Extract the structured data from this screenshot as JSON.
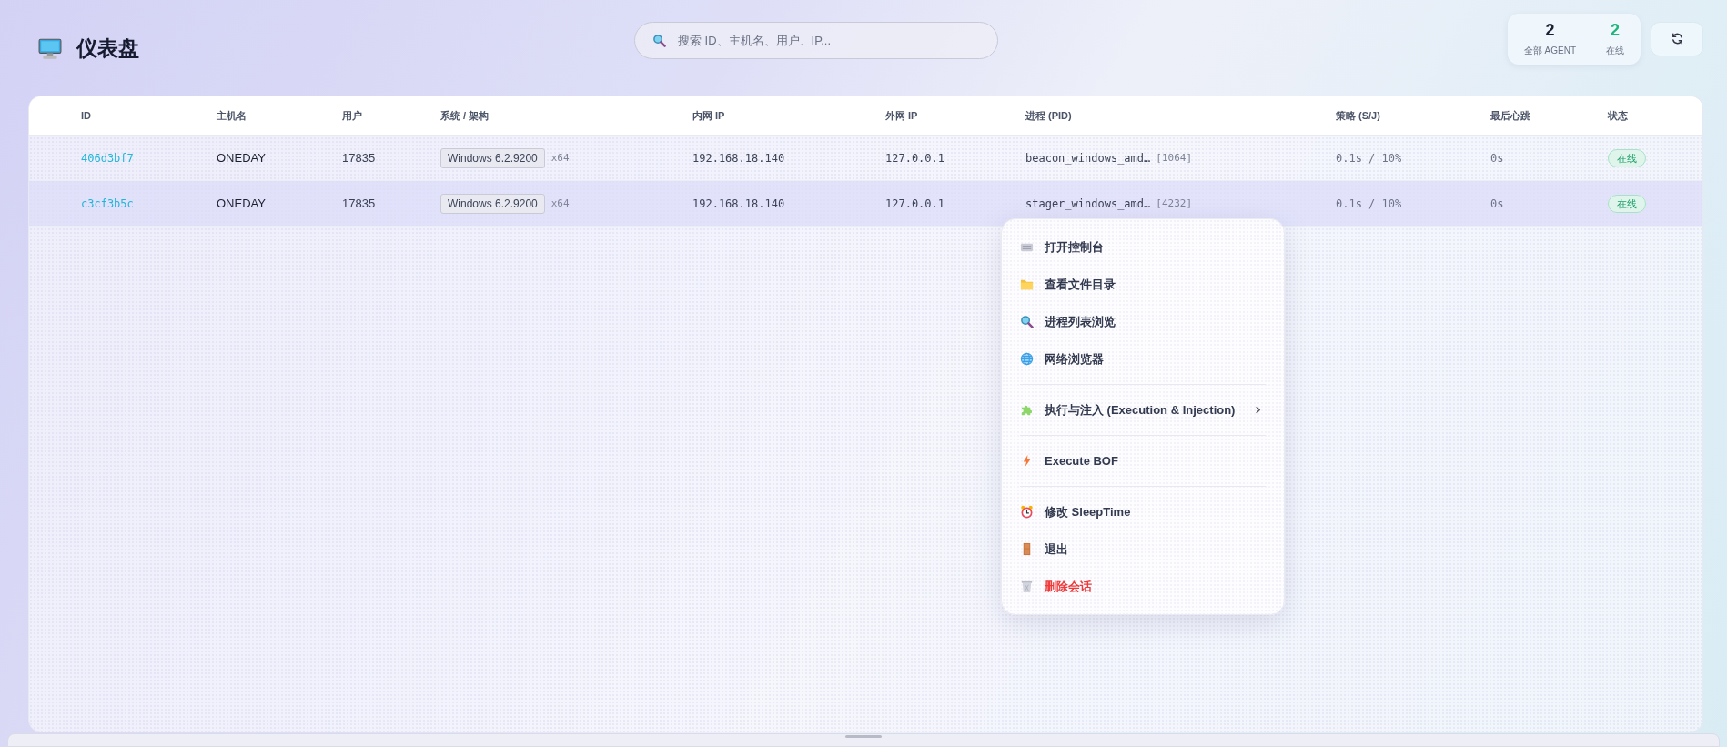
{
  "header": {
    "title": "仪表盘",
    "search": {
      "placeholder": "搜索 ID、主机名、用户、IP..."
    },
    "stats": [
      {
        "value": "2",
        "label": "全部 AGENT",
        "kind": "total"
      },
      {
        "value": "2",
        "label": "在线",
        "kind": "online"
      }
    ]
  },
  "table": {
    "columns": [
      "ID",
      "主机名",
      "用户",
      "系统 / 架构",
      "内网 IP",
      "外网 IP",
      "进程 (PID)",
      "策略 (S/J)",
      "最后心跳",
      "状态"
    ],
    "rows": [
      {
        "id": "406d3bf7",
        "host": "ONEDAY",
        "user": "17835",
        "os": "Windows 6.2.9200",
        "arch": "x64",
        "internal_ip": "192.168.18.140",
        "external_ip": "127.0.0.1",
        "process": "beacon_windows_amd…",
        "pid": "[1064]",
        "policy": "0.1s / 10%",
        "heartbeat": "0s",
        "status": "在线",
        "selected": false
      },
      {
        "id": "c3cf3b5c",
        "host": "ONEDAY",
        "user": "17835",
        "os": "Windows 6.2.9200",
        "arch": "x64",
        "internal_ip": "192.168.18.140",
        "external_ip": "127.0.0.1",
        "process": "stager_windows_amd…",
        "pid": "[4232]",
        "policy": "0.1s / 10%",
        "heartbeat": "0s",
        "status": "在线",
        "selected": true
      }
    ]
  },
  "context_menu": {
    "groups": [
      [
        {
          "label": "打开控制台",
          "danger": false,
          "has_submenu": false
        },
        {
          "label": "查看文件目录",
          "danger": false,
          "has_submenu": false
        },
        {
          "label": "进程列表浏览",
          "danger": false,
          "has_submenu": false
        },
        {
          "label": "网络浏览器",
          "danger": false,
          "has_submenu": false
        }
      ],
      [
        {
          "label": "执行与注入 (Execution & Injection)",
          "danger": false,
          "has_submenu": true
        }
      ],
      [
        {
          "label": "Execute BOF",
          "danger": false,
          "has_submenu": false
        }
      ],
      [
        {
          "label": "修改 SleepTime",
          "danger": false,
          "has_submenu": false
        },
        {
          "label": "退出",
          "danger": false,
          "has_submenu": false
        },
        {
          "label": "删除会话",
          "danger": true,
          "has_submenu": false
        }
      ]
    ]
  }
}
